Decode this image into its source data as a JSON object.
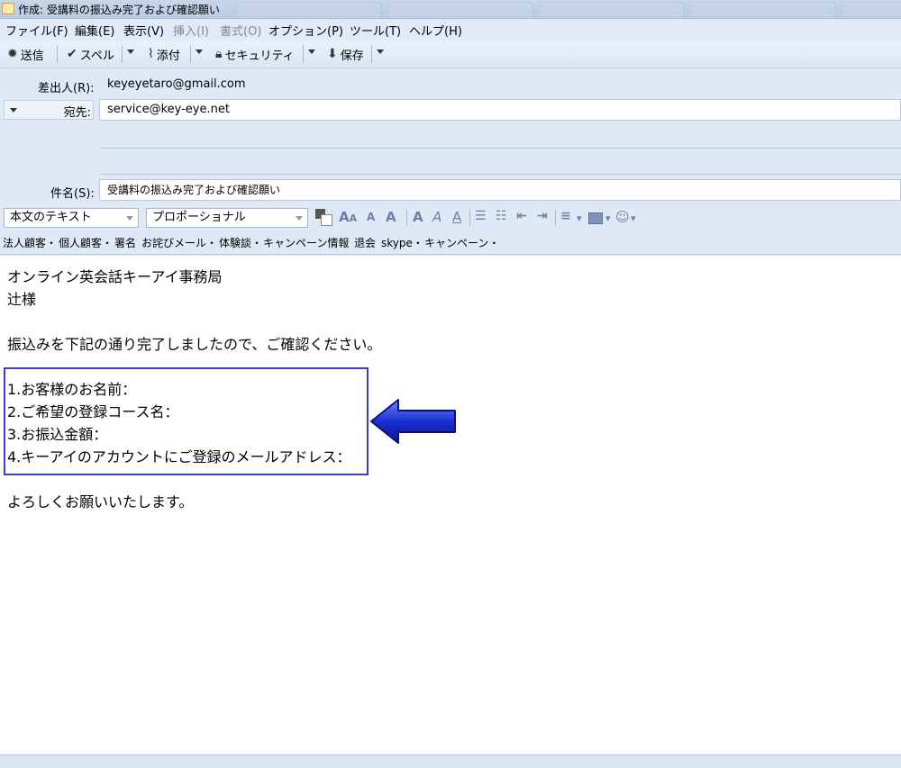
{
  "window": {
    "title": "作成: 受講料の振込み完了および確認願い"
  },
  "menu": [
    "ファイル(F)",
    "編集(E)",
    "表示(V)",
    "挿入(I)",
    "書式(O)",
    "オプション(P)",
    "ツール(T)",
    "ヘルプ(H)"
  ],
  "toolbar": {
    "send": "送信",
    "spell": "スペル",
    "attach": "添付",
    "security": "セキュリティ",
    "save": "保存"
  },
  "headers": {
    "from_label": "差出人(R):",
    "from_value": "keyeyetaro@gmail.com",
    "to_label": "宛先:",
    "to_value": "service@key-eye.net",
    "subject_label": "件名(S):",
    "subject_value": "受講料の振込み完了および確認願い"
  },
  "format": {
    "paragraph_style": "本文のテキスト",
    "font": "プロポーショナル"
  },
  "templates": [
    "法人顧客・",
    "個人顧客・",
    "署名",
    "お詫びメール・",
    "体験談・",
    "キャンペーン情報",
    "退会",
    "skype・",
    "キャンペーン・"
  ],
  "message": {
    "line1": "オンライン英会話キーアイ事務局",
    "line2": "辻様",
    "line3": "振込みを下記の通り完了しましたので、ご確認ください。",
    "item1": "1.お客様のお名前：",
    "item2": "2.ご希望の登録コース名：",
    "item3": "3.お振込金額：",
    "item4": "4.キーアイのアカウントにご登録のメールアドレス：",
    "closing": "よろしくお願いいたします。"
  },
  "colors": {
    "highlight_border": "#3b3fc4",
    "arrow_fill": "#1a2fd0",
    "arrow_stroke": "#0b0f7a"
  }
}
